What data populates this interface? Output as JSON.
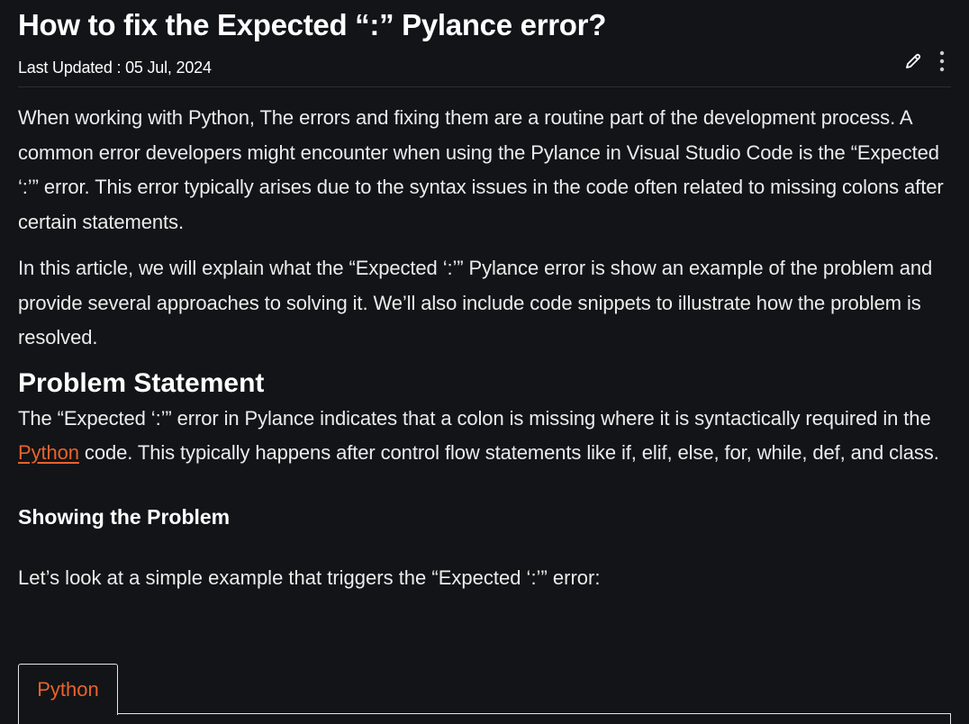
{
  "article": {
    "title": "How to fix the Expected “:” Pylance error?",
    "last_updated": "Last Updated : 05 Jul, 2024",
    "tools": {
      "edit_icon": "pencil-icon",
      "more_icon": "vertical-dots-icon"
    },
    "intro_paragraphs": [
      "When working with Python, The errors and fixing them are a routine part of the development process. A common error developers might encounter when using the Pylance in Visual Studio Code is the “Expected ‘:’” error. This error typically arises due to the syntax issues in the code often related to missing colons after certain statements.",
      "In this article, we will explain what the “Expected ‘:’” Pylance error is show an example of the problem and provide several approaches to solving it. We’ll also include code snippets to illustrate how the problem is resolved."
    ],
    "problem_heading": "Problem Statement",
    "problem_text_before_link": "The “Expected ‘:’” error in Pylance indicates that a colon is missing where it is syntactically required in the ",
    "problem_link_text": "Python",
    "problem_text_after_link": " code. This typically happens after control flow statements like if, elif, else, for, while, def, and class.",
    "showing_heading": "Showing the Problem",
    "example_intro": "Let’s look at a simple example that triggers the “Expected ‘:’” error:",
    "code_tab_label": "Python"
  },
  "colors": {
    "background": "#131417",
    "text": "#ececec",
    "accent": "#e8632d"
  }
}
